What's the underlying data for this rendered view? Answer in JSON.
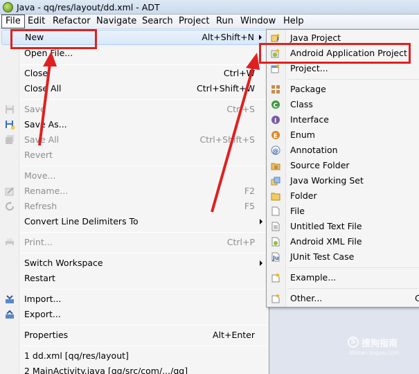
{
  "window": {
    "title": "Java - qq/res/layout/dd.xml - ADT"
  },
  "menubar": {
    "items": [
      {
        "label": "File",
        "active": true
      },
      {
        "label": "Edit"
      },
      {
        "label": "Refactor"
      },
      {
        "label": "Navigate"
      },
      {
        "label": "Search"
      },
      {
        "label": "Project"
      },
      {
        "label": "Run"
      },
      {
        "label": "Window"
      },
      {
        "label": "Help"
      }
    ]
  },
  "file_menu": {
    "items": [
      {
        "label": "New",
        "shortcut": "Alt+Shift+N"
      },
      {
        "label": "Open File..."
      },
      {
        "label": "Close",
        "shortcut": "Ctrl+W"
      },
      {
        "label": "Close All",
        "shortcut": "Ctrl+Shift+W"
      },
      {
        "label": "Save",
        "shortcut": "Ctrl+S"
      },
      {
        "label": "Save As..."
      },
      {
        "label": "Save All",
        "shortcut": "Ctrl+Shift+S"
      },
      {
        "label": "Revert"
      },
      {
        "label": "Move..."
      },
      {
        "label": "Rename...",
        "shortcut": "F2"
      },
      {
        "label": "Refresh",
        "shortcut": "F5"
      },
      {
        "label": "Convert Line Delimiters To"
      },
      {
        "label": "Print...",
        "shortcut": "Ctrl+P"
      },
      {
        "label": "Switch Workspace"
      },
      {
        "label": "Restart"
      },
      {
        "label": "Import..."
      },
      {
        "label": "Export..."
      },
      {
        "label": "Properties",
        "shortcut": "Alt+Enter"
      },
      {
        "label": "1 dd.xml  [qq/res/layout]"
      },
      {
        "label": "2 MainActivity.java  [qq/src/com/.../qq]"
      }
    ]
  },
  "new_submenu": {
    "items": [
      {
        "label": "Java Project",
        "icon": "java-project-icon"
      },
      {
        "label": "Android Application Project",
        "icon": "android-project-icon"
      },
      {
        "label": "Project...",
        "icon": "project-icon"
      },
      {
        "label": "Package",
        "icon": "package-icon"
      },
      {
        "label": "Class",
        "icon": "class-icon"
      },
      {
        "label": "Interface",
        "icon": "interface-icon"
      },
      {
        "label": "Enum",
        "icon": "enum-icon"
      },
      {
        "label": "Annotation",
        "icon": "annotation-icon"
      },
      {
        "label": "Source Folder",
        "icon": "source-folder-icon"
      },
      {
        "label": "Java Working Set",
        "icon": "working-set-icon"
      },
      {
        "label": "Folder",
        "icon": "folder-icon"
      },
      {
        "label": "File",
        "icon": "file-icon"
      },
      {
        "label": "Untitled Text File",
        "icon": "text-file-icon"
      },
      {
        "label": "Android XML File",
        "icon": "android-xml-icon"
      },
      {
        "label": "JUnit Test Case",
        "icon": "junit-icon"
      },
      {
        "label": "Example...",
        "icon": "example-icon"
      },
      {
        "label": "Other...",
        "icon": "other-icon",
        "shortcut": "C"
      }
    ]
  },
  "watermark": {
    "brand": "搜狗指南",
    "url": "zhinan.sogou.com",
    "glyph": "S"
  },
  "colors": {
    "highlight": "#e02020",
    "menu_bg": "#f5f5f5",
    "hover": "#d9e8fa"
  }
}
